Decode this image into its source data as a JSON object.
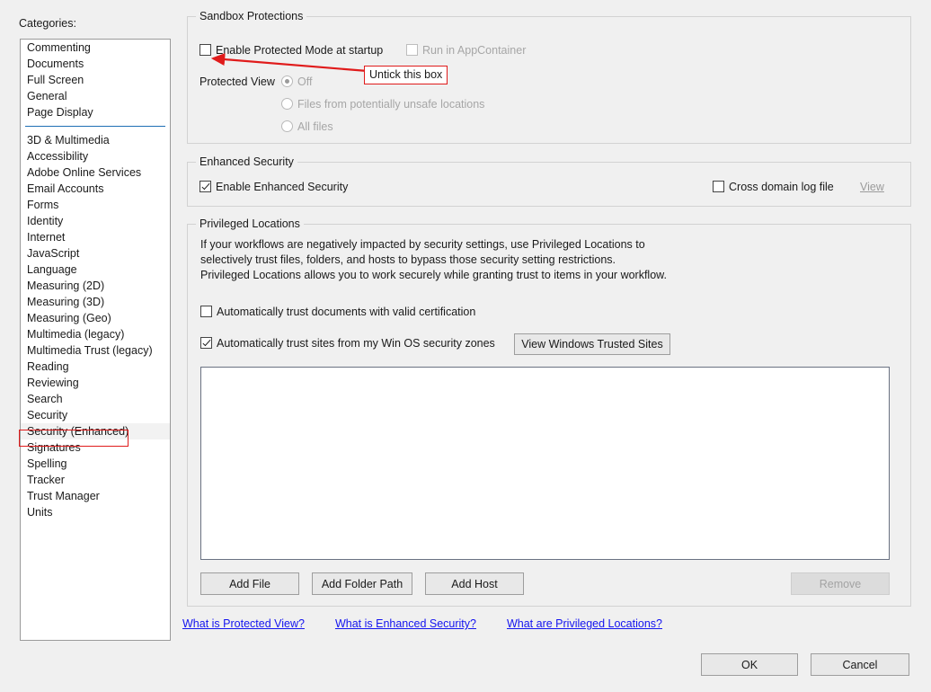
{
  "sidebar": {
    "label": "Categories:",
    "group_one": [
      {
        "label": "Commenting"
      },
      {
        "label": "Documents"
      },
      {
        "label": "Full Screen"
      },
      {
        "label": "General"
      },
      {
        "label": "Page Display"
      }
    ],
    "group_two": [
      {
        "label": "3D & Multimedia"
      },
      {
        "label": "Accessibility"
      },
      {
        "label": "Adobe Online Services"
      },
      {
        "label": "Email Accounts"
      },
      {
        "label": "Forms"
      },
      {
        "label": "Identity"
      },
      {
        "label": "Internet"
      },
      {
        "label": "JavaScript"
      },
      {
        "label": "Language"
      },
      {
        "label": "Measuring (2D)"
      },
      {
        "label": "Measuring (3D)"
      },
      {
        "label": "Measuring (Geo)"
      },
      {
        "label": "Multimedia (legacy)"
      },
      {
        "label": "Multimedia Trust (legacy)"
      },
      {
        "label": "Reading"
      },
      {
        "label": "Reviewing"
      },
      {
        "label": "Search"
      },
      {
        "label": "Security"
      },
      {
        "label": "Security (Enhanced)",
        "selected": true
      },
      {
        "label": "Signatures"
      },
      {
        "label": "Spelling"
      },
      {
        "label": "Tracker"
      },
      {
        "label": "Trust Manager"
      },
      {
        "label": "Units"
      }
    ]
  },
  "sandbox": {
    "title": "Sandbox Protections",
    "protected_mode_label": "Enable Protected Mode at startup",
    "protected_mode_checked": false,
    "appcontainer_label": "Run in AppContainer",
    "appcontainer_checked": false,
    "appcontainer_disabled": true,
    "protected_view_label": "Protected View",
    "protected_view_options": [
      {
        "label": "Off",
        "selected": true
      },
      {
        "label": "Files from potentially unsafe locations",
        "selected": false
      },
      {
        "label": "All files",
        "selected": false
      }
    ]
  },
  "enhanced": {
    "title": "Enhanced Security",
    "enable_label": "Enable Enhanced Security",
    "enable_checked": true,
    "cross_domain_label": "Cross domain log file",
    "cross_domain_checked": false,
    "view_link": "View",
    "view_link_disabled": true
  },
  "privileged": {
    "title": "Privileged Locations",
    "description": "If your workflows are negatively impacted by security settings, use Privileged Locations to selectively trust files, folders, and hosts to bypass those security setting restrictions. Privileged Locations allows you to work securely while granting trust to items in your workflow.",
    "trust_docs_label": "Automatically trust documents with valid certification",
    "trust_docs_checked": false,
    "trust_sites_label": "Automatically trust sites from my Win OS security zones",
    "trust_sites_checked": true,
    "view_trusted_sites_button": "View Windows Trusted Sites",
    "list_items": [],
    "add_file_button": "Add File",
    "add_folder_button": "Add Folder Path",
    "add_host_button": "Add Host",
    "remove_button": "Remove",
    "remove_disabled": true
  },
  "help_links": [
    {
      "label": "What is Protected View?"
    },
    {
      "label": "What is Enhanced Security?"
    },
    {
      "label": "What are Privileged Locations?"
    }
  ],
  "dialog_buttons": {
    "ok": "OK",
    "cancel": "Cancel"
  },
  "annotation": {
    "callout_text": "Untick this box",
    "color": "#e01b1b",
    "target": "enable-protected-mode-checkbox"
  },
  "colors": {
    "background": "#f0f0f0",
    "link_blue": "#1414ef",
    "separator_blue": "#1f6fb5",
    "annotation_red": "#e01b1b",
    "listbox_border": "#6a7282",
    "disabled_text": "#a6a6a6"
  }
}
